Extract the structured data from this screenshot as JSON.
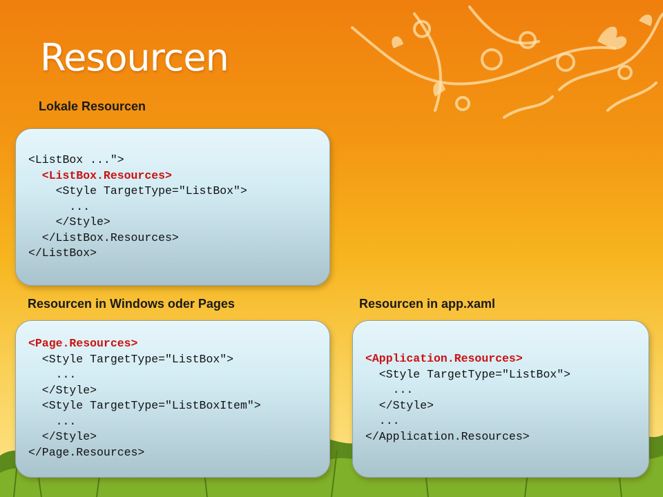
{
  "title": "Resourcen",
  "colors": {
    "background_top": "#f07f0e",
    "background_bottom": "#fde68f",
    "accent_code": "#cc1111",
    "box_fill": "#d2ebf3"
  },
  "sections": {
    "local": {
      "heading": "Lokale Resourcen",
      "lines": [
        "<ListBox ...\">",
        "  <ListBox.Resources>",
        "    <Style TargetType=\"ListBox\">",
        "      ...",
        "    </Style>",
        "  </ListBox.Resources>",
        "</ListBox>"
      ]
    },
    "windows": {
      "heading": "Resourcen in Windows oder Pages",
      "lines": [
        "<Page.Resources>",
        "  <Style TargetType=\"ListBox\">",
        "    ...",
        "  </Style>",
        "  <Style TargetType=\"ListBoxItem\">",
        "    ...",
        "  </Style>",
        "</Page.Resources>"
      ]
    },
    "app": {
      "heading": "Resourcen in app.xaml",
      "lines": [
        "<Application.Resources>",
        "  <Style TargetType=\"ListBox\">",
        "    ...",
        "  </Style>",
        "  ...",
        "</Application.Resources>"
      ]
    }
  }
}
